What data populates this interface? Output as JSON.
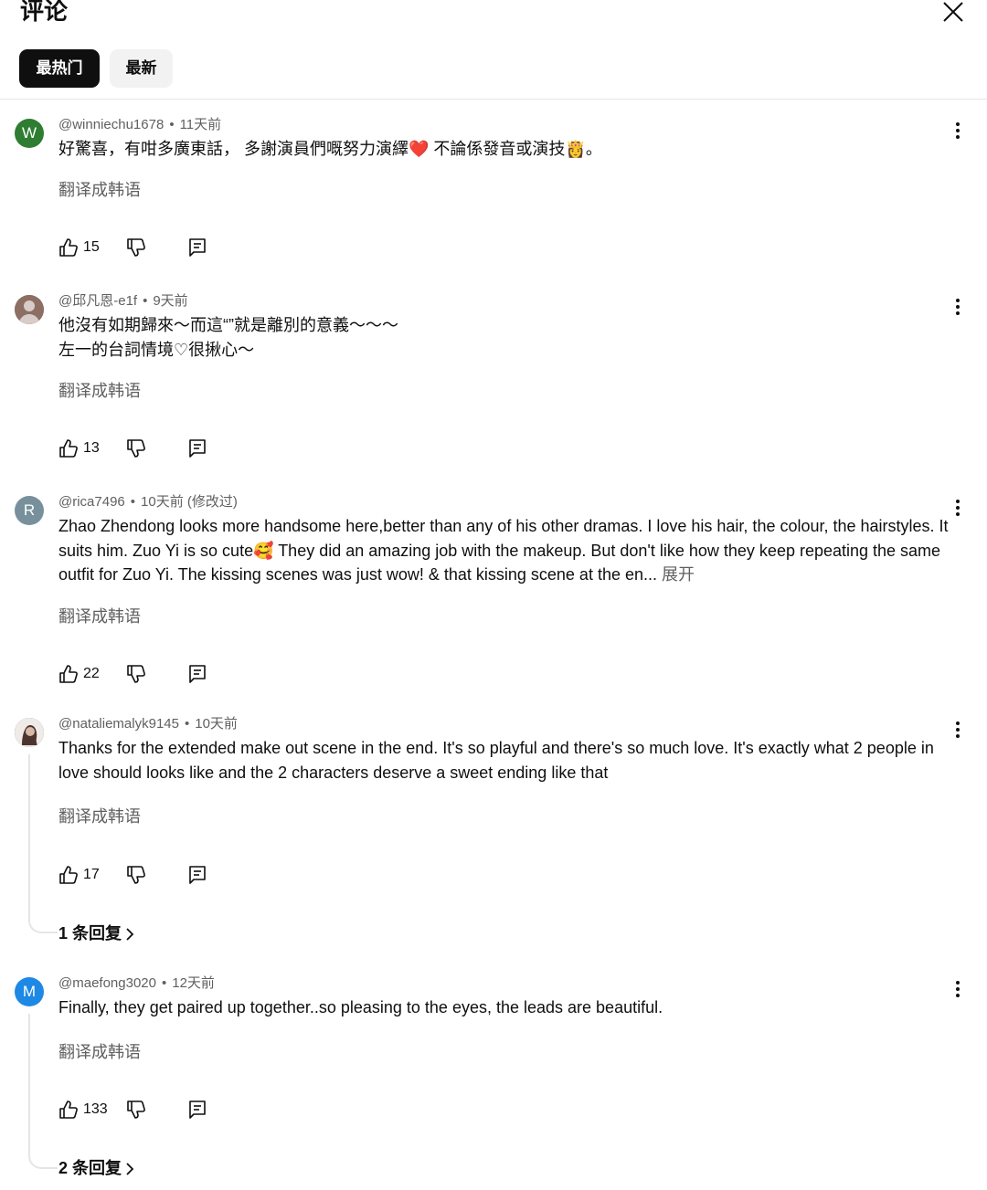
{
  "header": {
    "title": "评论",
    "tabs": {
      "hot": "最热门",
      "newest": "最新"
    }
  },
  "translate_label": "翻译成韩语",
  "expand_label": "展开",
  "comments": [
    {
      "avatar_letter": "W",
      "avatar_color": "#2e7d32",
      "author": "@winniechu1678",
      "time": "11天前",
      "text_a": "好驚喜，有咁多廣東話， 多謝演員們嘅努力演繹",
      "emoji_a": "❤️",
      "text_b": " 不論係發音或演技",
      "emoji_b": "👸",
      "text_c": "。",
      "likes": "15"
    },
    {
      "avatar_letter": "",
      "avatar_color": "#8d6e63",
      "author": "@邱凡恩-e1f",
      "time": "9天前",
      "line1": "他沒有如期歸來～而這“”就是離別的意義～～～",
      "line2": "左一的台詞情境♡很揪心～",
      "likes": "13"
    },
    {
      "avatar_letter": "R",
      "avatar_color": "#78909c",
      "author": "@rica7496",
      "time": "10天前 (修改过)",
      "text_a": "Zhao Zhendong looks more handsome here,better than any of his other dramas. I love his hair, the colour, the hairstyles. It suits him. Zuo Yi is so cute",
      "emoji_a": "🥰",
      "text_b": " They did an amazing job with the makeup. But don't like how they keep repeating the same outfit for Zuo Yi. The kissing scenes was just wow! & that kissing scene at the en... ",
      "likes": "22"
    },
    {
      "avatar_letter": "",
      "avatar_color": "#5d4037",
      "author": "@nataliemalyk9145",
      "time": "10天前",
      "text": "Thanks for the extended make out scene in the end. It's so playful and there's so much love. It's exactly what 2 people in love should looks like and the 2 characters deserve a sweet ending like that",
      "likes": "17",
      "replies": "1 条回复"
    },
    {
      "avatar_letter": "M",
      "avatar_color": "#1e88e5",
      "author": "@maefong3020",
      "time": "12天前",
      "text": "Finally, they get paired up together..so pleasing to the eyes, the leads are beautiful.",
      "likes": "133",
      "replies": "2 条回复"
    }
  ]
}
